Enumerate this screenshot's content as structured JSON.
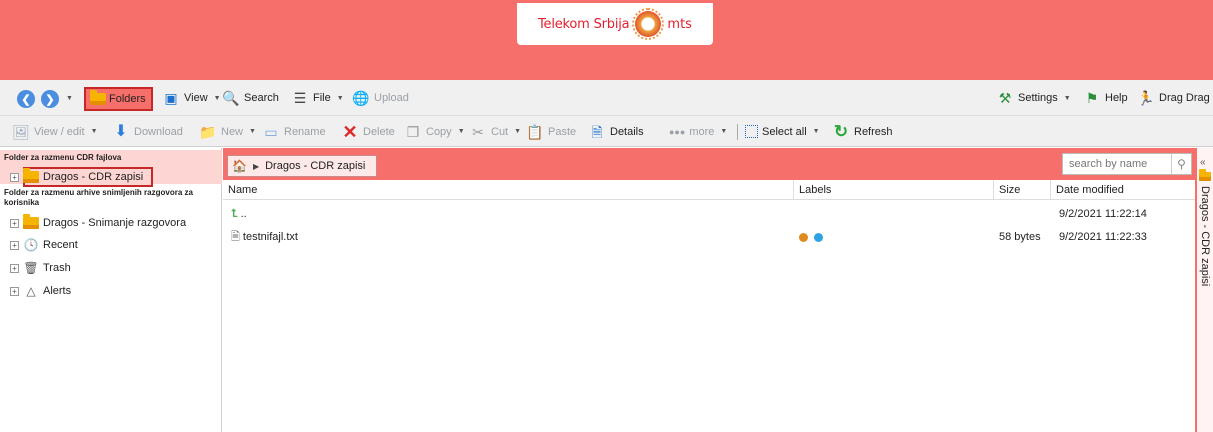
{
  "header": {
    "brand_name": "Telekom Srbija",
    "brand_suffix": "mts"
  },
  "toolbar1": {
    "folders": "Folders",
    "view": "View",
    "search": "Search",
    "file": "File",
    "upload": "Upload",
    "settings": "Settings",
    "help": "Help",
    "drag": "Drag Drag"
  },
  "toolbar2": {
    "view_edit": "View / edit",
    "download": "Download",
    "new": "New",
    "rename": "Rename",
    "delete": "Delete",
    "copy": "Copy",
    "cut": "Cut",
    "paste": "Paste",
    "details": "Details",
    "more": "more",
    "select_all": "Select all",
    "refresh": "Refresh"
  },
  "tree": {
    "group1_label": "Folder za razmenu CDR fajlova",
    "group1_item": "Dragos - CDR zapisi",
    "group2_label": "Folder za razmenu arhive snimljenih razgovora za korisnika",
    "items": [
      {
        "label": "Dragos - Snimanje razgovora",
        "icon": "folder-icon"
      },
      {
        "label": "Recent",
        "icon": "clock-icon"
      },
      {
        "label": "Trash",
        "icon": "trash-icon"
      },
      {
        "label": "Alerts",
        "icon": "bell-icon"
      }
    ]
  },
  "breadcrumb": {
    "current": "Dragos - CDR zapisi"
  },
  "search": {
    "placeholder": "search by name"
  },
  "grid": {
    "columns": [
      "Name",
      "Labels",
      "Size",
      "Date modified"
    ],
    "rows": [
      {
        "name": "..",
        "labels": [],
        "size": "",
        "date": "9/2/2021 11:22:14"
      },
      {
        "name": "testnifajl.txt",
        "labels": [
          "#e08a1e",
          "#2ea3e0"
        ],
        "size": "58 bytes",
        "date": "9/2/2021 11:22:33"
      }
    ]
  },
  "right_rail": {
    "label": "Dragos - CDR zapisi"
  },
  "colors": {
    "accent": "#f66f6a",
    "highlight_border": "#c62828"
  }
}
